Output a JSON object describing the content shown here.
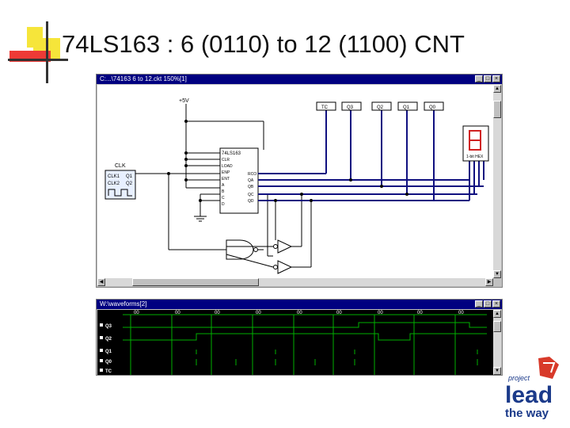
{
  "slide": {
    "title": "74LS163 : 6 (0110) to 12 (1100) CNT"
  },
  "schematic_window": {
    "title": "C:...\\74163 6 to 12.ckt 150%[1]",
    "minimize": "_",
    "maximize": "□",
    "close": "×",
    "power_label": "+5V",
    "clock_label": "CLK",
    "clock_pins": [
      "CLK1",
      "CLK2"
    ],
    "clock_outputs": [
      "Q1",
      "Q2"
    ],
    "chip_name": "74LS163",
    "chip_left_pins": [
      "CLR",
      "LOAD",
      "ENP",
      "ENT",
      "A",
      "B",
      "C",
      "D"
    ],
    "chip_right_pins": [
      "RCO",
      "QA",
      "QB",
      "QC",
      "QD"
    ],
    "probes": [
      "TC",
      "Q3",
      "Q2",
      "Q1",
      "Q0"
    ],
    "display_value": "8",
    "display_label": "1-bit HEX"
  },
  "waveform_window": {
    "title": "W:\\waveforms[2]",
    "minimize": "_",
    "maximize": "□",
    "close": "×",
    "signals": [
      "Q3",
      "Q2",
      "Q1",
      "Q0",
      "TC"
    ],
    "time_labels": [
      "00",
      "00",
      "00",
      "00",
      "00",
      "00",
      "00",
      "00",
      "00"
    ],
    "colors": {
      "trace": "#00b000",
      "background": "#000000",
      "label": "#ffffff"
    }
  },
  "logo": {
    "line1": "project",
    "line2": "lead",
    "line3": "the way"
  }
}
